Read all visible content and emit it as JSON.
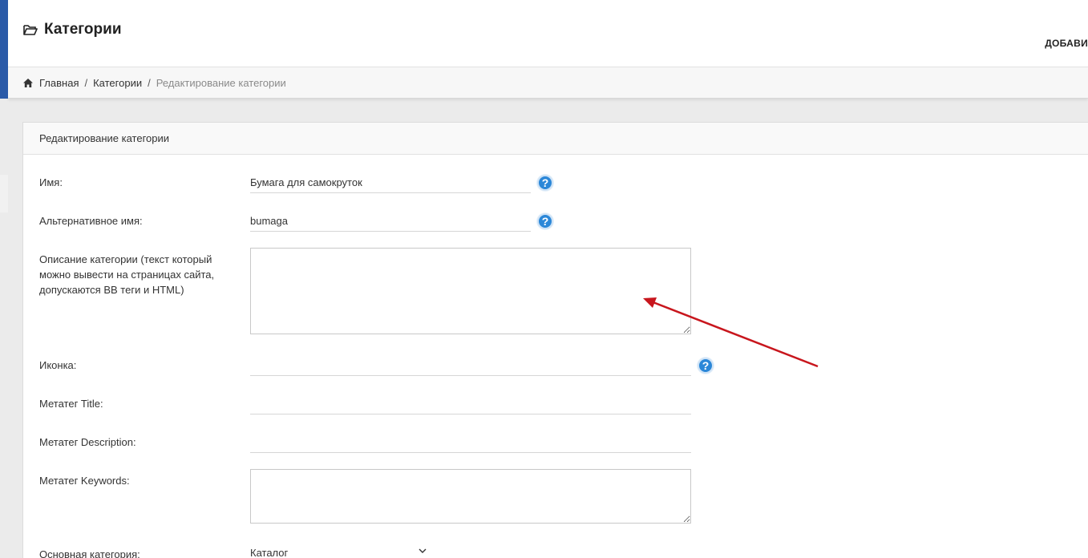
{
  "header": {
    "title": "Категории",
    "title_icon": "folder-open-icon",
    "right_action": "ДОБАВИ"
  },
  "breadcrumb": {
    "home_icon": "home-icon",
    "items": [
      "Главная",
      "Категории"
    ],
    "separator": "/",
    "current": "Редактирование категории"
  },
  "panel": {
    "title": "Редактирование категории"
  },
  "form": {
    "name_label": "Имя:",
    "name_value": "Бумага для самокруток",
    "alt_name_label": "Альтернативное имя:",
    "alt_name_value": "bumaga",
    "description_label": "Описание категории (текст который можно вывести на страницах сайта, допускаются BB теги и HTML)",
    "description_value": "",
    "icon_label": "Иконка:",
    "icon_value": "",
    "meta_title_label": "Метатег Title:",
    "meta_title_value": "",
    "meta_description_label": "Метатег Description:",
    "meta_description_value": "",
    "meta_keywords_label": "Метатег Keywords:",
    "meta_keywords_value": "",
    "parent_label": "Основная категория:",
    "parent_value": "Каталог"
  },
  "help_icon_glyph": "?",
  "colors": {
    "accent": "#2a5aa8",
    "help_icon": "#2b87d8",
    "annotation_arrow": "#c8161d"
  }
}
